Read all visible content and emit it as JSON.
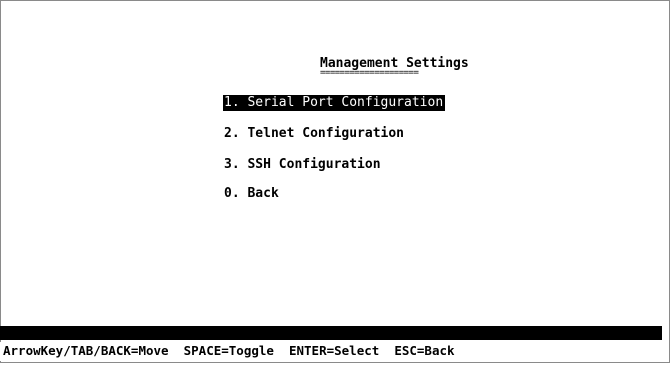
{
  "screen": {
    "title": "Management Settings",
    "title_underline": "===================="
  },
  "menu": {
    "items": [
      {
        "label": "1. Serial Port Configuration",
        "selected": true
      },
      {
        "label": "2. Telnet Configuration",
        "selected": false
      },
      {
        "label": "3. SSH Configuration",
        "selected": false
      },
      {
        "label": "0. Back",
        "selected": false
      }
    ]
  },
  "footer": {
    "help": "ArrowKey/TAB/BACK=Move  SPACE=Toggle  ENTER=Select  ESC=Back"
  },
  "colors": {
    "background": "#ffffff",
    "text": "#000000",
    "highlight_bg": "#000000",
    "highlight_text": "#ffffff"
  }
}
